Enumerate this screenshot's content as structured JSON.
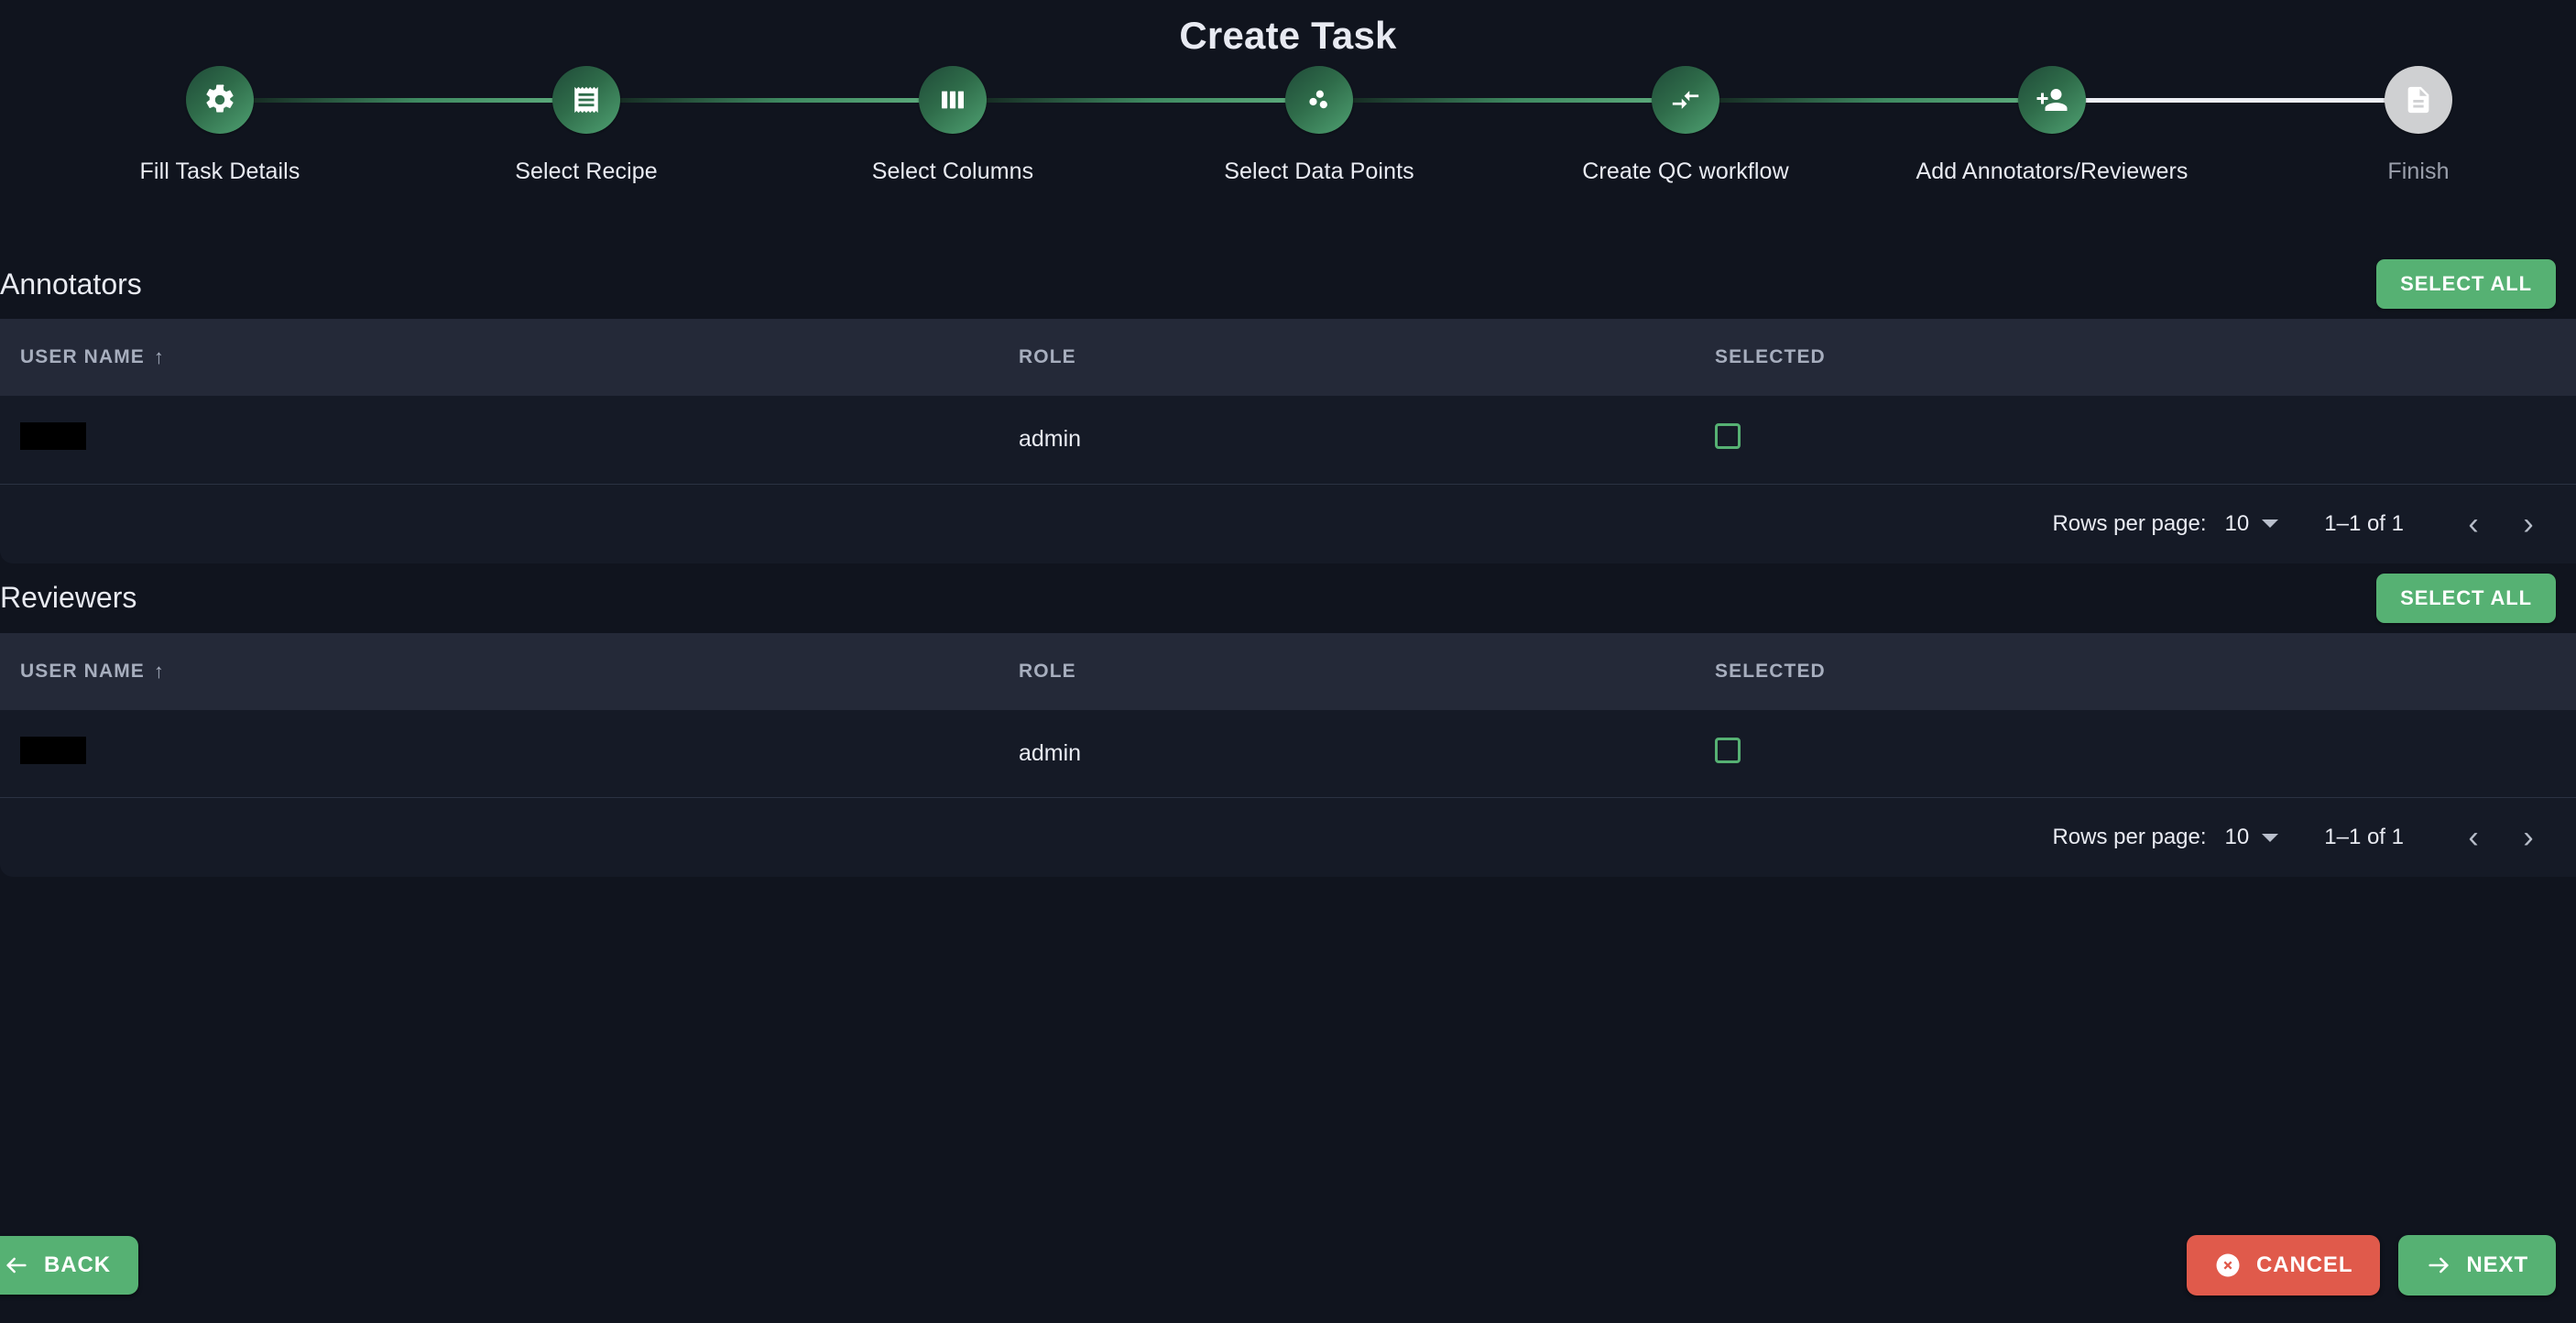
{
  "header": {
    "title": "Create Task"
  },
  "stepper": {
    "steps": [
      {
        "label": "Fill Task Details",
        "icon": "gear-icon",
        "state": "done"
      },
      {
        "label": "Select Recipe",
        "icon": "receipt-icon",
        "state": "done"
      },
      {
        "label": "Select Columns",
        "icon": "view-column-icon",
        "state": "done"
      },
      {
        "label": "Select Data Points",
        "icon": "scatter-points-icon",
        "state": "done"
      },
      {
        "label": "Create QC workflow",
        "icon": "compare-arrows-icon",
        "state": "done"
      },
      {
        "label": "Add Annotators/Reviewers",
        "icon": "person-add-icon",
        "state": "active"
      },
      {
        "label": "Finish",
        "icon": "document-icon",
        "state": "pending"
      }
    ],
    "colors": {
      "active_circle": "#2f6c4a",
      "pending_circle": "#cfd0d2",
      "done_line": "#5aa87a",
      "pending_line": "#eceef4"
    }
  },
  "sections": [
    {
      "id": "annotators",
      "title": "Annotators",
      "select_all_label": "SELECT ALL",
      "columns": [
        "USER NAME",
        "ROLE",
        "SELECTED"
      ],
      "sort_column": "USER NAME",
      "sort_direction": "asc",
      "rows": [
        {
          "user_name": "",
          "redacted": true,
          "role": "admin",
          "selected": false
        }
      ],
      "pagination": {
        "rows_per_page_label": "Rows per page:",
        "rows_per_page_value": "10",
        "range": "1–1 of 1",
        "prev_icon": "chevron-left-icon",
        "next_icon": "chevron-right-icon"
      }
    },
    {
      "id": "reviewers",
      "title": "Reviewers",
      "select_all_label": "SELECT ALL",
      "columns": [
        "USER NAME",
        "ROLE",
        "SELECTED"
      ],
      "sort_column": "USER NAME",
      "sort_direction": "asc",
      "rows": [
        {
          "user_name": "",
          "redacted": true,
          "role": "admin",
          "selected": false
        }
      ],
      "pagination": {
        "rows_per_page_label": "Rows per page:",
        "rows_per_page_value": "10",
        "range": "1–1 of 1",
        "prev_icon": "chevron-left-icon",
        "next_icon": "chevron-right-icon"
      }
    }
  ],
  "footer": {
    "back_label": "BACK",
    "cancel_label": "CANCEL",
    "next_label": "NEXT",
    "back_icon": "arrow-left-icon",
    "cancel_icon": "cancel-circle-icon",
    "next_icon": "arrow-right-icon",
    "green": "#56b173",
    "red": "#e05a4b"
  }
}
